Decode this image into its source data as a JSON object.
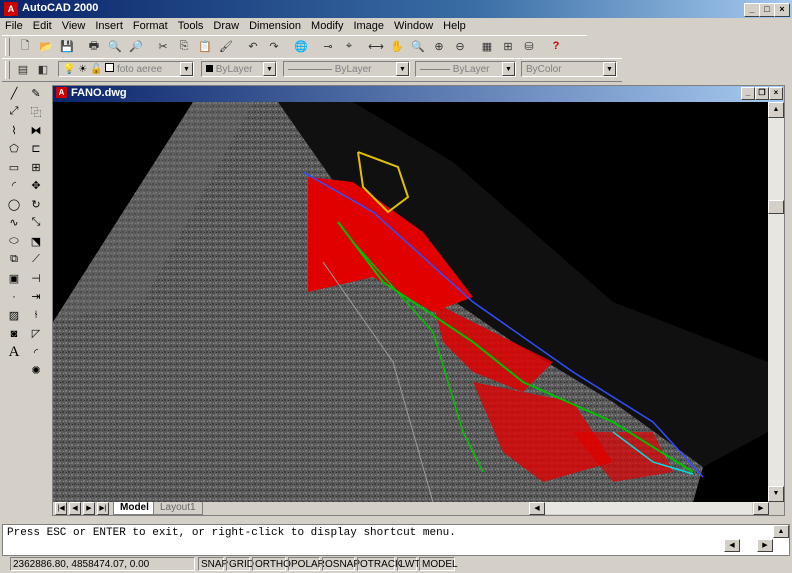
{
  "app": {
    "title": "AutoCAD 2000"
  },
  "menu": [
    "File",
    "Edit",
    "View",
    "Insert",
    "Format",
    "Tools",
    "Draw",
    "Dimension",
    "Modify",
    "Image",
    "Window",
    "Help"
  ],
  "properties_bar": {
    "layer": "foto aeree",
    "color": "ByLayer",
    "linetype": "ByLayer",
    "lineweight": "ByLayer",
    "plotstyle": "ByColor"
  },
  "document": {
    "title": "FANO.dwg",
    "tabs": [
      "Model",
      "Layout1"
    ]
  },
  "command": {
    "prompt": "Press ESC or ENTER to exit, or right-click to display shortcut menu."
  },
  "status": {
    "coords": "2362886.80, 4858474.07, 0.00",
    "toggles": [
      "SNAP",
      "GRID",
      "ORTHO",
      "POLAR",
      "OSNAP",
      "OTRACK",
      "LWT",
      "MODEL"
    ]
  },
  "icons": {
    "standard_toolbar": [
      "new-icon",
      "open-icon",
      "save-icon",
      "print-icon",
      "preview-icon",
      "find-icon",
      "cut-icon",
      "copy-icon",
      "paste-icon",
      "matchprop-icon",
      "undo-icon",
      "redo-icon",
      "hyperlink-icon",
      "tracking-icon",
      "ucs-icon",
      "distance-icon",
      "pan-icon",
      "zoom-icon",
      "zoom-window-icon",
      "zoom-prev-icon",
      "properties-icon",
      "designcenter-icon",
      "dbconnect-icon",
      "help-icon"
    ],
    "draw_toolbar": [
      "line-icon",
      "xline-icon",
      "polyline-icon",
      "polygon-icon",
      "rectangle-icon",
      "arc-icon",
      "circle-icon",
      "spline-icon",
      "ellipse-icon",
      "insert-block-icon",
      "make-block-icon",
      "point-icon",
      "hatch-icon",
      "region-icon",
      "text-icon"
    ],
    "modify_toolbar": [
      "erase-icon",
      "copy-obj-icon",
      "mirror-icon",
      "offset-icon",
      "array-icon",
      "move-icon",
      "rotate-icon",
      "scale-icon",
      "stretch-icon",
      "lengthen-icon",
      "trim-icon",
      "extend-icon",
      "break-icon",
      "chamfer-icon",
      "fillet-icon",
      "explode-icon"
    ]
  }
}
